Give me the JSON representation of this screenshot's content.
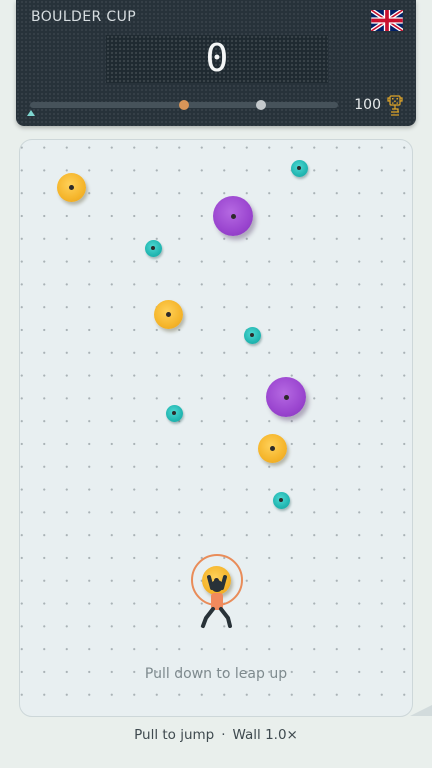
{
  "scoreboard": {
    "event_title": "BOULDER CUP",
    "country_flag_icon": "uk-flag-icon",
    "score": "0",
    "goal_value": "100",
    "goal_icon": "trophy-icon",
    "progress": {
      "current_marker": 0.5,
      "best_marker": 0.75,
      "current_color": "#d99558",
      "best_color": "#c4c9cc"
    }
  },
  "wall": {
    "hint": "Pull down to leap up",
    "hold_colors": {
      "yellow": "#f5b52b",
      "purple": "#9a45cf",
      "teal": "#22b7b2"
    },
    "climber_icon": "climber-icon",
    "aim_ring_color": "#e98c59"
  },
  "footer": {
    "action": "Pull to jump",
    "separator": "·",
    "wall_label": "Wall 1.0×"
  }
}
